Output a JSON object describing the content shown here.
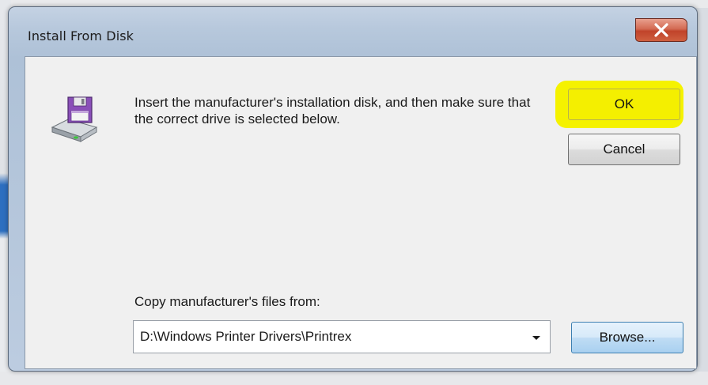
{
  "window": {
    "title": "Install From Disk",
    "close_glyph": "X"
  },
  "dialog": {
    "icon": "floppy-disk-drive-icon",
    "message": "Insert the manufacturer's installation disk, and then make sure that the correct drive is selected below.",
    "ok_label": "OK",
    "cancel_label": "Cancel",
    "copy_label": "Copy manufacturer's files from:",
    "path_value": "D:\\Windows Printer Drivers\\Printrex",
    "browse_label": "Browse..."
  },
  "colors": {
    "ok_highlight": "#f5f200",
    "close_button": "#c74a30",
    "title_bar": "#b7c8dc",
    "client": "#f0f0f0"
  }
}
